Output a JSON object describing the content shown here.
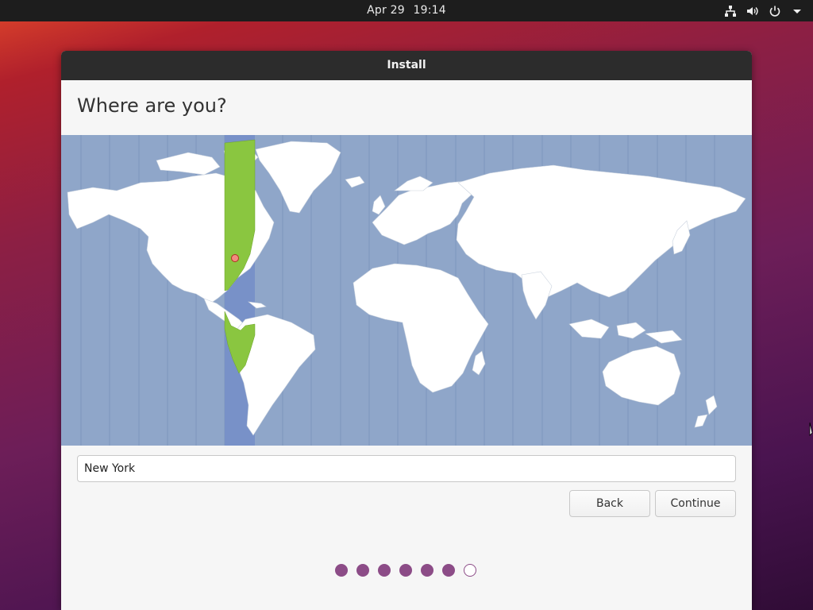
{
  "topbar": {
    "date": "Apr 29",
    "time": "19:14",
    "icons": [
      "network-icon",
      "volume-icon",
      "power-icon",
      "menu-arrow-icon"
    ]
  },
  "window": {
    "title": "Install",
    "heading": "Where are you?"
  },
  "map": {
    "selected_city": "New York",
    "highlight_color": "#8ac640",
    "water_color": "#8fa6c9",
    "band_color": "#7891c8"
  },
  "location_field": {
    "value": "New York"
  },
  "buttons": {
    "back": "Back",
    "continue": "Continue"
  },
  "progress": {
    "steps": 7,
    "current_step": 7,
    "color": "#8c4c87"
  }
}
